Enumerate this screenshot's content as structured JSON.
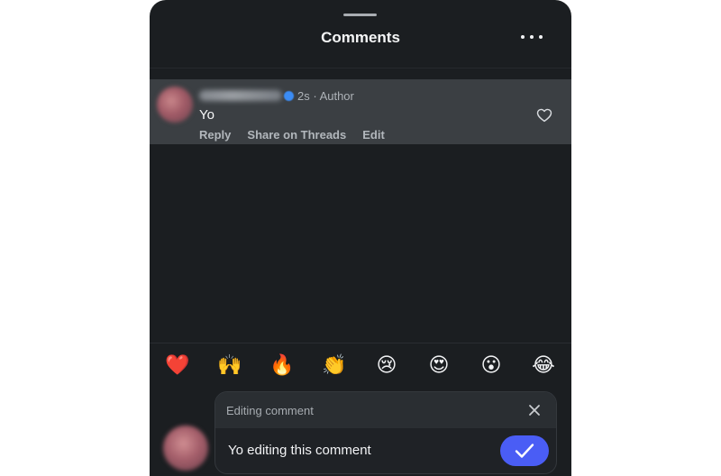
{
  "sheet": {
    "title": "Comments",
    "more_icon": "more-horizontal-icon"
  },
  "comment": {
    "username": "jonahmanzano",
    "username_blurred": true,
    "verified": true,
    "meta": "2s · Author",
    "text": "Yo",
    "like_icon": "heart-outline-icon",
    "actions": {
      "reply": "Reply",
      "share": "Share on Threads",
      "edit": "Edit"
    }
  },
  "emoji_bar": {
    "items": [
      {
        "glyph": "❤️",
        "name": "red-heart"
      },
      {
        "glyph": "🙌",
        "name": "raising-hands"
      },
      {
        "glyph": "🔥",
        "name": "fire"
      },
      {
        "glyph": "👏",
        "name": "clapping-hands"
      },
      {
        "glyph": "😢",
        "name": "crying-face"
      },
      {
        "glyph": "😍",
        "name": "heart-eyes"
      },
      {
        "glyph": "😮",
        "name": "face-open-mouth"
      },
      {
        "glyph": "😂",
        "name": "tears-of-joy"
      }
    ]
  },
  "composer": {
    "header_label": "Editing comment",
    "close_icon": "close-icon",
    "input_value": "Yo editing this comment",
    "submit_icon": "checkmark-icon"
  },
  "colors": {
    "background": "#1b1e21",
    "highlight_row": "#3b3f43",
    "accent": "#4a5df5",
    "verified": "#3b8cf5"
  }
}
